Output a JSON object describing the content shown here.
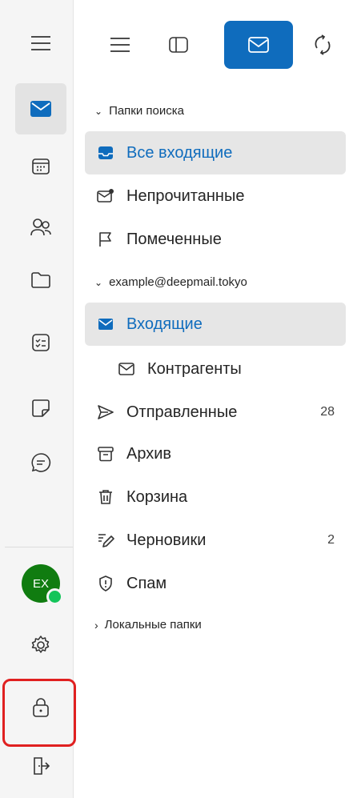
{
  "search_folders": {
    "header": "Папки поиска",
    "items": [
      {
        "label": "Все входящие",
        "icon": "inbox-filled-icon",
        "selected": true
      },
      {
        "label": "Непрочитанные",
        "icon": "mail-unread-icon"
      },
      {
        "label": "Помеченные",
        "icon": "flag-icon"
      }
    ]
  },
  "account": {
    "header": "example@deepmail.tokyo",
    "items": [
      {
        "label": "Входящие",
        "icon": "inbox-filled-icon",
        "selected": true
      },
      {
        "label": "Контрагенты",
        "icon": "mail-icon",
        "subfolder": true
      },
      {
        "label": "Отправленные",
        "icon": "send-icon",
        "count": "28"
      },
      {
        "label": "Архив",
        "icon": "archive-icon"
      },
      {
        "label": "Корзина",
        "icon": "trash-icon"
      },
      {
        "label": "Черновики",
        "icon": "draft-pen-icon",
        "count": "2"
      },
      {
        "label": "Спам",
        "icon": "shield-icon"
      }
    ]
  },
  "local_folders": {
    "header": "Локальные папки"
  },
  "user": {
    "initials": "EX",
    "status": "online"
  },
  "colors": {
    "accent": "#0f6cbd",
    "avatar": "#107c10",
    "presence": "#13c45a",
    "highlight": "#e02020"
  }
}
